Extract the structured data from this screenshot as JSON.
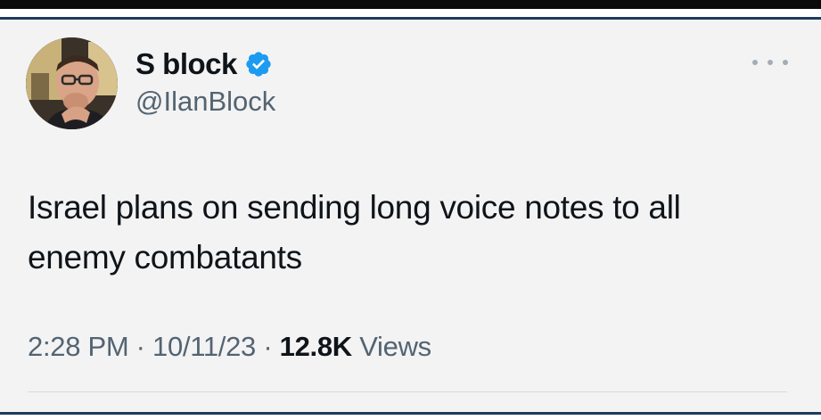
{
  "tweet": {
    "author": {
      "display_name": "S block",
      "handle": "@IlanBlock",
      "verified": true,
      "avatar_icon": "user-avatar"
    },
    "more_icon": "more-options-icon",
    "text_lines": [
      "Israel plans on sending long voice notes to all",
      "enemy combatants"
    ],
    "meta": {
      "time": "2:28 PM",
      "separator": " · ",
      "date": "10/11/23",
      "views_count": "12.8K",
      "views_label": "Views"
    }
  },
  "colors": {
    "background": "#f3f3f4",
    "text_primary": "#0f1419",
    "text_secondary": "#536471",
    "verified_blue": "#1d9bf0",
    "frame_line": "#1f3b5c"
  }
}
